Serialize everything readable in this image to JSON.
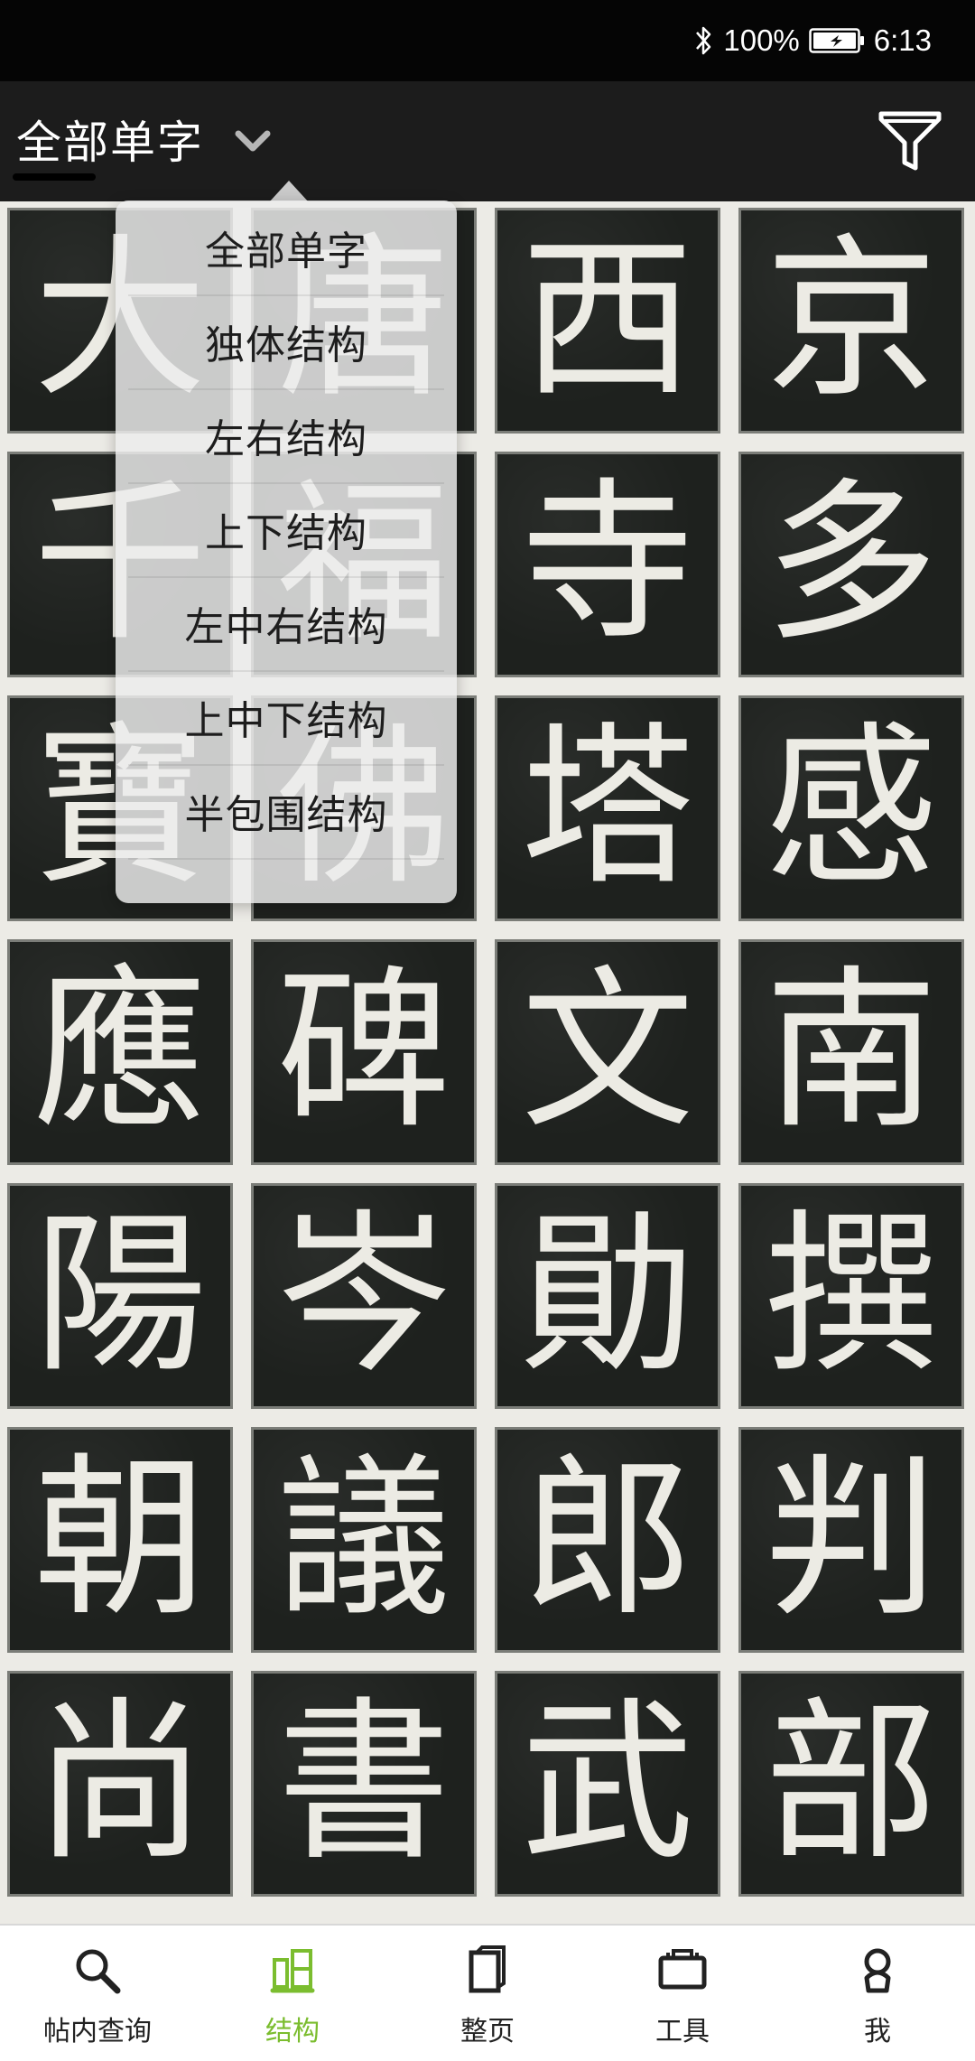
{
  "status_bar": {
    "battery_percent": "100%",
    "time": "6:13",
    "icons": [
      "bluetooth-icon",
      "battery-charging-icon"
    ]
  },
  "header": {
    "title": "全部单字",
    "icons": [
      "chevron-down-icon",
      "filter-icon"
    ]
  },
  "dropdown": {
    "items": [
      "全部单字",
      "独体结构",
      "左右结构",
      "上下结构",
      "左中右结构",
      "上中下结构",
      "半包围结构"
    ]
  },
  "grid": {
    "characters": [
      "大",
      "唐",
      "西",
      "京",
      "千",
      "福",
      "寺",
      "多",
      "寶",
      "佛",
      "塔",
      "感",
      "應",
      "碑",
      "文",
      "南",
      "陽",
      "岑",
      "勛",
      "撰",
      "朝",
      "議",
      "郎",
      "判",
      "尚",
      "書",
      "武",
      "部"
    ]
  },
  "bottom_nav": {
    "items": [
      {
        "label": "帖内查询",
        "icon": "search-icon",
        "active": false
      },
      {
        "label": "结构",
        "icon": "structure-icon",
        "active": true
      },
      {
        "label": "整页",
        "icon": "page-icon",
        "active": false
      },
      {
        "label": "工具",
        "icon": "toolbox-icon",
        "active": false
      },
      {
        "label": "我",
        "icon": "profile-icon",
        "active": false
      }
    ],
    "active_color": "#7bbd2f"
  }
}
